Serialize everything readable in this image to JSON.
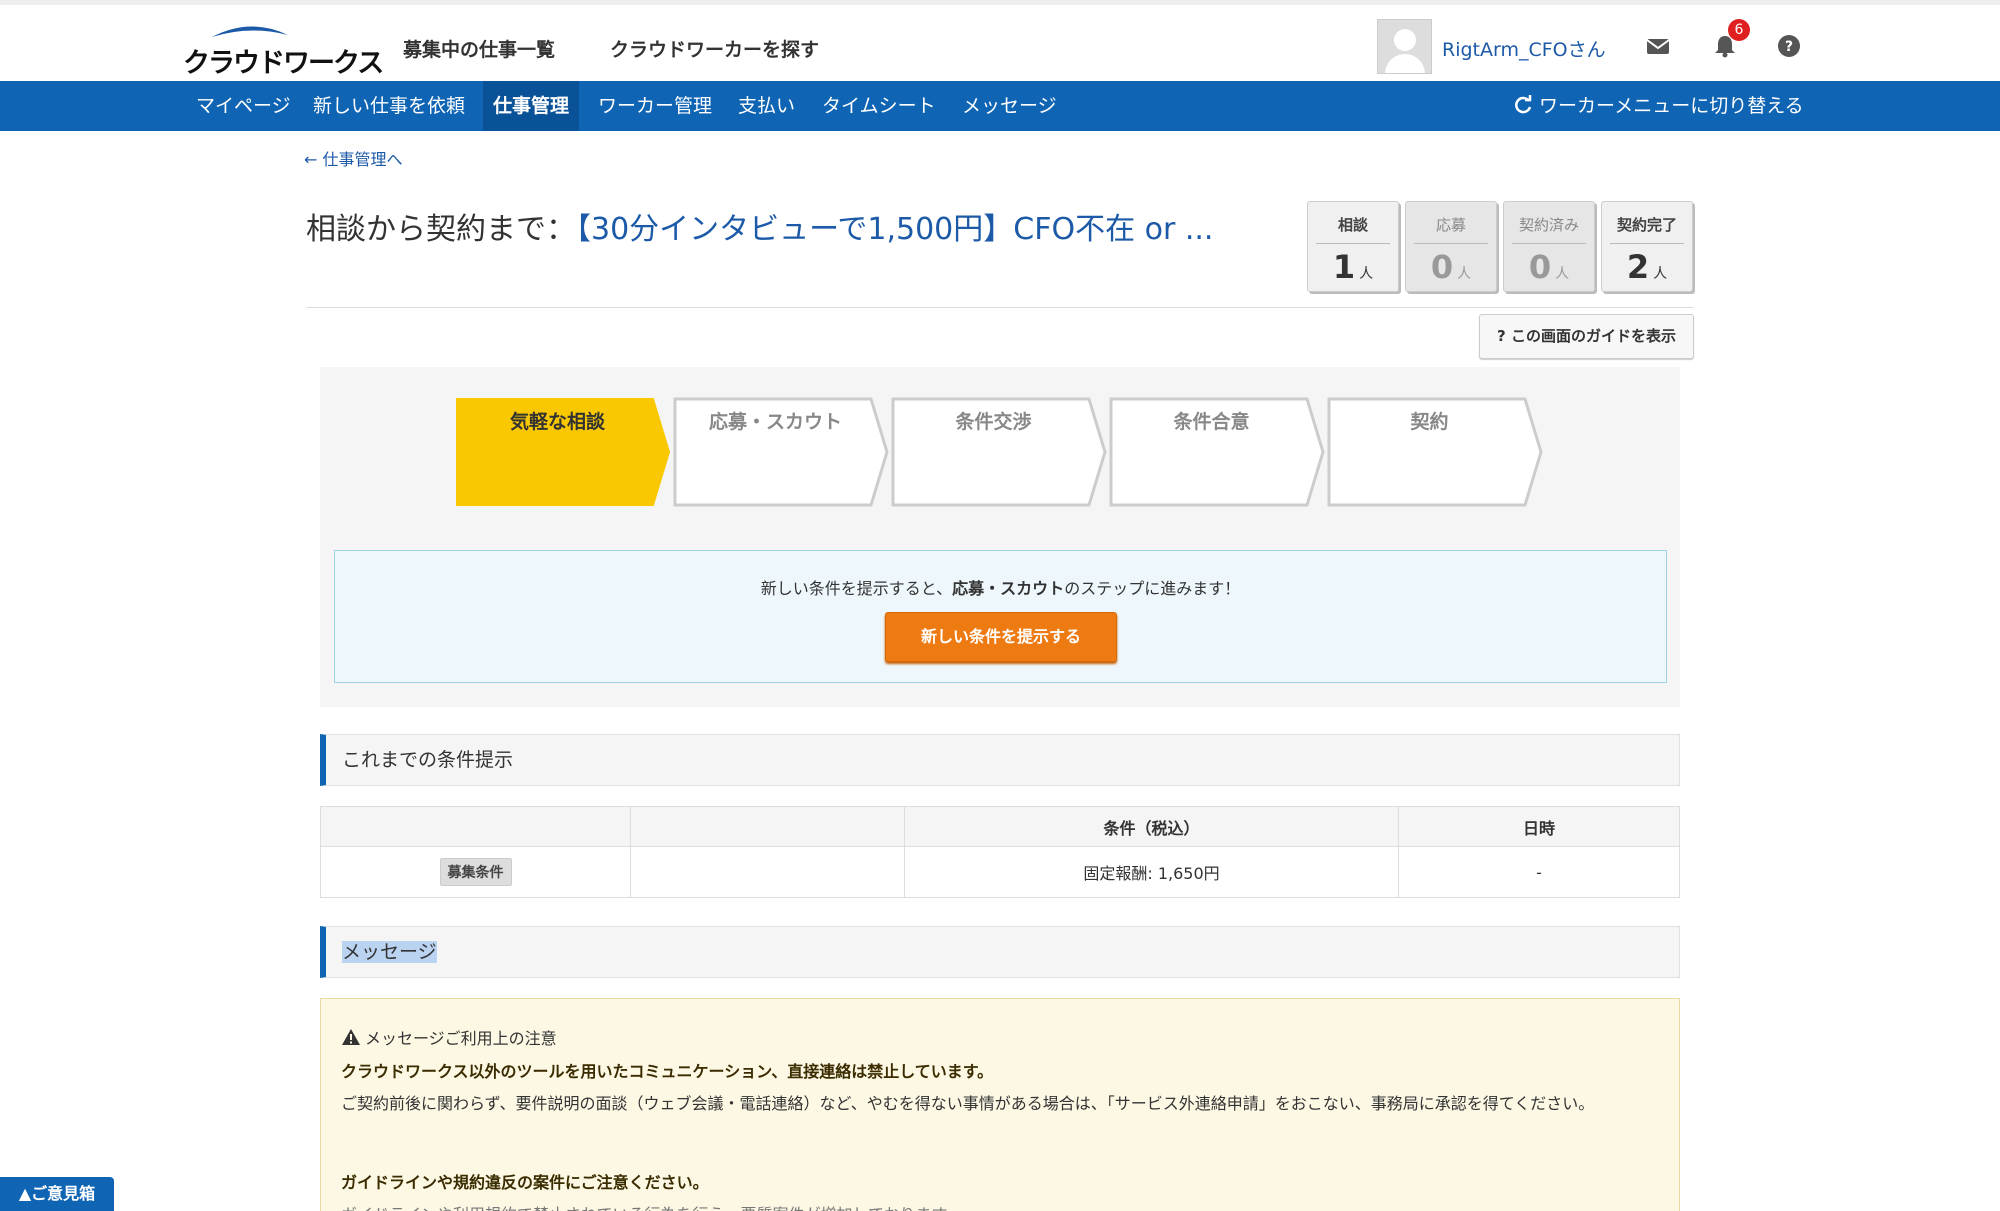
{
  "header": {
    "logo_text": "クラウドワークス",
    "nav": [
      "募集中の仕事一覧",
      "クラウドワーカーを探す"
    ],
    "username": "RigtArm_CFOさん",
    "notification_count": "6",
    "icons": [
      "mail-icon",
      "bell-icon",
      "help-icon"
    ]
  },
  "subnav": {
    "items": [
      "マイページ",
      "新しい仕事を依頼",
      "仕事管理",
      "ワーカー管理",
      "支払い",
      "タイムシート",
      "メッセージ"
    ],
    "active": "仕事管理",
    "switch_label": "ワーカーメニューに切り替える"
  },
  "back_link": "← 仕事管理へ",
  "page_title": {
    "prefix": "相談から契約まで：",
    "job_title": "【30分インタビューで1,500円】CFO不在 or ..."
  },
  "counters": [
    {
      "label": "相談",
      "value": "1",
      "unit": "人"
    },
    {
      "label": "応募",
      "value": "0",
      "unit": "人"
    },
    {
      "label": "契約済み",
      "value": "0",
      "unit": "人"
    },
    {
      "label": "契約完了",
      "value": "2",
      "unit": "人"
    }
  ],
  "guide_button": "? この画面のガイドを表示",
  "steps": [
    {
      "label": "気軽な相談",
      "active": true
    },
    {
      "label": "応募・スカウト",
      "active": false
    },
    {
      "label": "条件交渉",
      "active": false
    },
    {
      "label": "条件合意",
      "active": false
    },
    {
      "label": "契約",
      "active": false
    }
  ],
  "info": {
    "text_before": "新しい条件を提示すると、",
    "text_bold": "応募・スカウト",
    "text_after": "のステップに進みます！",
    "button": "新しい条件を提示する"
  },
  "conditions_section": {
    "title": "これまでの条件提示",
    "columns": [
      "",
      "",
      "条件（税込）",
      "日時"
    ],
    "rows": [
      {
        "tag": "募集条件",
        "col2": "",
        "condition": "固定報酬: 1,650円",
        "datetime": "-"
      }
    ]
  },
  "message_section": {
    "title": "メッセージ"
  },
  "notice": {
    "heading": "メッセージご利用上の注意",
    "line1": "クラウドワークス以外のツールを用いたコミュニケーション、直接連絡は禁止しています。",
    "line2": "ご契約前後に関わらず、要件説明の面談（ウェブ会議・電話連絡）など、やむを得ない事情がある場合は、「サービス外連絡申請」をおこない、事務局に承認を得てください。",
    "line3": "ガイドラインや規約違反の案件にご注意ください。",
    "line4": "ガイドラインや利用規約で禁止されている行為を行う、悪質案件が増加しております。"
  },
  "feedback_tab": "▲ご意見箱",
  "colors": {
    "brand_blue": "#0f64b4",
    "step_active": "#f9c800",
    "cta_orange": "#ee7a12",
    "notice_bg": "#fdf8e4"
  }
}
